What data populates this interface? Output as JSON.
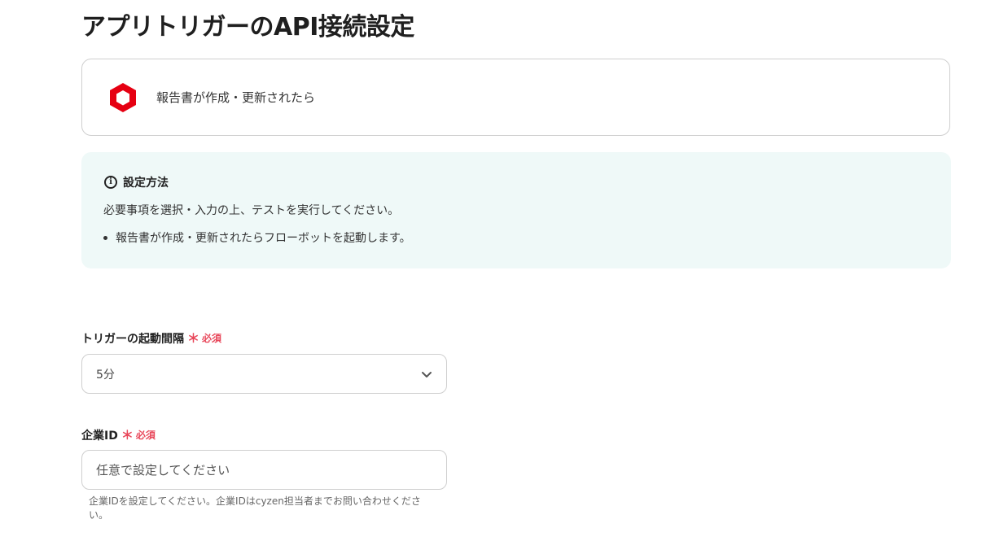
{
  "page": {
    "title": "アプリトリガーのAPI接続設定"
  },
  "trigger": {
    "label": "報告書が作成・更新されたら",
    "icon": "cyzen-logo-icon",
    "icon_color": "#e60012"
  },
  "info": {
    "title": "設定方法",
    "description": "必要事項を選択・入力の上、テストを実行してください。",
    "items": [
      "報告書が作成・更新されたらフローボットを起動します。"
    ],
    "background": "#eff9f8"
  },
  "fields": {
    "interval": {
      "label": "トリガーの起動間隔",
      "required_mark": "＊",
      "required_text": "必須",
      "value": "5分"
    },
    "company_id": {
      "label": "企業ID",
      "required_mark": "＊",
      "required_text": "必須",
      "placeholder": "任意で設定してください",
      "value": "",
      "help": "企業IDを設定してください。企業IDはcyzen担当者までお問い合わせください。"
    }
  },
  "colors": {
    "required": "#e8475a",
    "border": "#cfcfcf"
  }
}
